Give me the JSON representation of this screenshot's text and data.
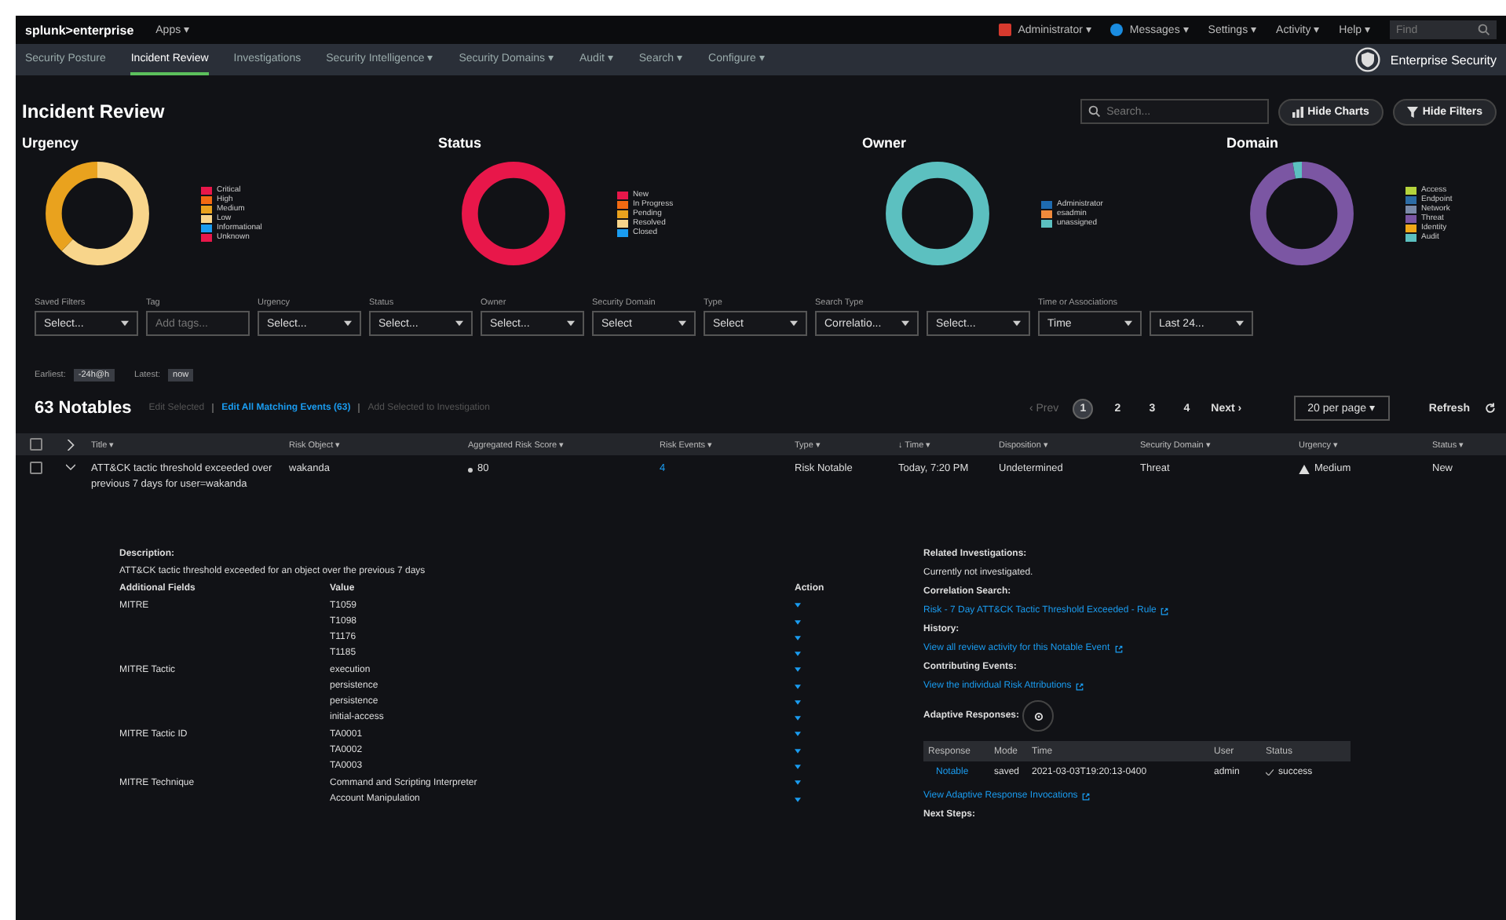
{
  "top_bar": {
    "logo": "splunk>enterprise",
    "apps": "Apps ▾",
    "items": [
      {
        "label": "Administrator ▾",
        "kind": "alert"
      },
      {
        "label": "Messages ▾",
        "kind": "messages"
      },
      {
        "label": "Settings ▾",
        "kind": "plain"
      },
      {
        "label": "Activity ▾",
        "kind": "plain"
      },
      {
        "label": "Help ▾",
        "kind": "plain"
      }
    ],
    "find": {
      "placeholder": "Find"
    }
  },
  "nav": {
    "tabs": [
      {
        "label": "Security Posture",
        "selected": false
      },
      {
        "label": "Incident Review",
        "selected": true
      },
      {
        "label": "Investigations",
        "selected": false
      },
      {
        "label": "Security Intelligence ▾",
        "selected": false
      },
      {
        "label": "Security Domains ▾",
        "selected": false
      },
      {
        "label": "Audit ▾",
        "selected": false
      },
      {
        "label": "Search ▾",
        "selected": false
      },
      {
        "label": "Configure ▾",
        "selected": false
      }
    ],
    "app_title": "Enterprise Security"
  },
  "page": {
    "title": "Incident Review",
    "search": {
      "placeholder": "Search..."
    },
    "buttons": [
      "Hide Charts",
      "Hide Filters"
    ]
  },
  "charts": [
    {
      "title": "Urgency",
      "legend": [
        {
          "label": "Critical",
          "color": "#e8174a"
        },
        {
          "label": "High",
          "color": "#f26a12"
        },
        {
          "label": "Medium",
          "color": "#e9a21e"
        },
        {
          "label": "Low",
          "color": "#f8d58b"
        },
        {
          "label": "Informational",
          "color": "#1a9cf0"
        },
        {
          "label": "Unknown",
          "color": "#e8174a"
        }
      ]
    },
    {
      "title": "Status",
      "legend": [
        {
          "label": "New",
          "color": "#e8174a"
        },
        {
          "label": "In Progress",
          "color": "#f26a12"
        },
        {
          "label": "Pending",
          "color": "#e9a21e"
        },
        {
          "label": "Resolved",
          "color": "#f8d58b"
        },
        {
          "label": "Closed",
          "color": "#1a9cf0"
        }
      ]
    },
    {
      "title": "Owner",
      "legend": [
        {
          "label": "Administrator",
          "color": "#1e6bb0"
        },
        {
          "label": "esadmin",
          "color": "#f08a3c"
        },
        {
          "label": "unassigned",
          "color": "#5cc0c0"
        }
      ]
    },
    {
      "title": "Domain",
      "legend": [
        {
          "label": "Access",
          "color": "#b5d33c"
        },
        {
          "label": "Endpoint",
          "color": "#2c6ca5"
        },
        {
          "label": "Network",
          "color": "#7a8aa8"
        },
        {
          "label": "Threat",
          "color": "#7b56a3"
        },
        {
          "label": "Identity",
          "color": "#f0a818"
        },
        {
          "label": "Audit",
          "color": "#5cc0c0"
        }
      ]
    }
  ],
  "filters": [
    {
      "label": "Saved Filters",
      "controls": [
        {
          "kind": "select",
          "value": "Select..."
        }
      ]
    },
    {
      "label": "Tag",
      "controls": [
        {
          "kind": "input",
          "placeholder": "Add tags..."
        }
      ]
    },
    {
      "label": "Urgency",
      "controls": [
        {
          "kind": "select",
          "value": "Select..."
        }
      ]
    },
    {
      "label": "Status",
      "controls": [
        {
          "kind": "select",
          "value": "Select..."
        }
      ]
    },
    {
      "label": "Owner",
      "controls": [
        {
          "kind": "select",
          "value": "Select..."
        }
      ]
    },
    {
      "label": "Security Domain",
      "controls": [
        {
          "kind": "select",
          "value": "Select"
        }
      ]
    },
    {
      "label": "Type",
      "controls": [
        {
          "kind": "select",
          "value": "Select"
        }
      ]
    },
    {
      "label": "Search Type",
      "controls": [
        {
          "kind": "select",
          "value": "Correlatio..."
        },
        {
          "kind": "select",
          "value": "Select..."
        }
      ]
    },
    {
      "label": "Time or Associations",
      "controls": [
        {
          "kind": "select",
          "value": "Time"
        },
        {
          "kind": "select",
          "value": "Last 24..."
        }
      ]
    }
  ],
  "chips": [
    {
      "label": "Earliest:",
      "value": "-24h@h"
    },
    {
      "label": "Latest:",
      "value": "now"
    }
  ],
  "notables": {
    "count": "63 Notables",
    "actions": [
      {
        "label": "Edit Selected",
        "disabled": true
      },
      {
        "label": "Edit All Matching Events (63)",
        "disabled": false
      },
      {
        "label": "Add Selected to Investigation",
        "disabled": true
      }
    ],
    "prev": "‹ Prev",
    "pages": [
      {
        "label": "1",
        "selected": true
      },
      {
        "label": "2",
        "selected": false
      },
      {
        "label": "3",
        "selected": false
      },
      {
        "label": "4",
        "selected": false
      }
    ],
    "next": "Next ›",
    "per_page": "20 per page ▾",
    "refresh": "Refresh"
  },
  "table": {
    "select_all_checked": false,
    "columns": [
      "Title ▾",
      "Risk Object ▾",
      "Aggregated Risk Score ▾",
      "Risk Events ▾",
      "Type ▾",
      "↓ Time ▾",
      "Disposition ▾",
      "Security Domain ▾",
      "Urgency ▾",
      "Status ▾"
    ],
    "rows": [
      {
        "checked": false,
        "expanded": true,
        "title": "ATT&CK tactic threshold exceeded over previous 7 days for user=wakanda",
        "risk_object": "wakanda",
        "risk_score": "80",
        "risk_events": "4",
        "type": "Risk Notable",
        "time": "Today, 7:20 PM",
        "disposition": "Undetermined",
        "domain": "Threat",
        "urgency": "Medium",
        "status": "New"
      }
    ]
  },
  "detail": {
    "description_label": "Description:",
    "description": "ATT&CK tactic threshold exceeded for an object over the previous 7 days",
    "headers": [
      "Additional Fields",
      "Value",
      "Action"
    ],
    "fields": [
      {
        "name": "MITRE",
        "values": [
          "T1059",
          "T1098",
          "T1176",
          "T1185"
        ]
      },
      {
        "name": "MITRE Tactic",
        "values": [
          "execution",
          "persistence",
          "persistence",
          "initial-access"
        ]
      },
      {
        "name": "MITRE Tactic ID",
        "values": [
          "TA0001",
          "TA0002",
          "TA0003"
        ]
      },
      {
        "name": "MITRE Technique",
        "values": [
          "Command and Scripting Interpreter",
          "Account Manipulation"
        ]
      }
    ],
    "sections": [
      {
        "label": "Related Investigations:",
        "kind": "text",
        "text": "Currently not investigated."
      },
      {
        "label": "Correlation Search:",
        "kind": "link",
        "text": "Risk - 7 Day ATT&CK Tactic Threshold Exceeded - Rule"
      },
      {
        "label": "History:",
        "kind": "link",
        "text": "View all review activity for this Notable Event"
      },
      {
        "label": "Contributing Events:",
        "kind": "link",
        "text": "View the individual Risk Attributions"
      }
    ],
    "adaptive": {
      "label": "Adaptive Responses:",
      "columns": [
        "Response",
        "Mode",
        "Time",
        "User",
        "Status"
      ],
      "rows": [
        {
          "response": "Notable",
          "mode": "saved",
          "time": "2021-03-03T19:20:13-0400",
          "user": "admin",
          "status": "success"
        }
      ],
      "link": "View Adaptive Response Invocations"
    },
    "next_steps": "Next Steps:"
  }
}
